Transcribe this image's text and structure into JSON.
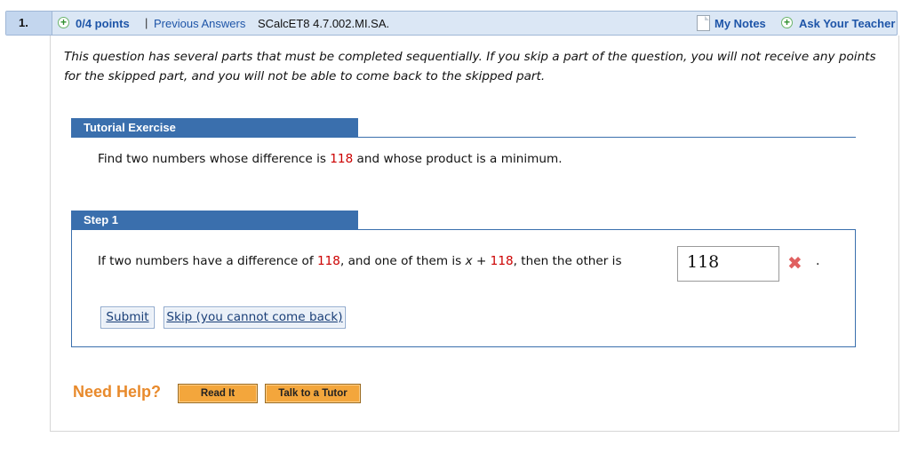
{
  "question": {
    "number": "1.",
    "points": "0/4 points",
    "separator": "|",
    "previous_answers": "Previous Answers",
    "id": "SCalcET8 4.7.002.MI.SA.",
    "my_notes": "My Notes",
    "ask_teacher": "Ask Your Teacher"
  },
  "intro": "This question has several parts that must be completed sequentially. If you skip a part of the question, you will not receive any points for the skipped part, and you will not be able to come back to the skipped part.",
  "tutorial": {
    "heading": "Tutorial Exercise",
    "problem_part1": "Find two numbers whose difference is ",
    "problem_value": "118",
    "problem_part2": " and whose product is a minimum."
  },
  "step": {
    "heading": "Step 1",
    "text_part1": "If two numbers have a difference of ",
    "diff_value": "118",
    "text_part2": ", and one of them is ",
    "var_x": "x",
    "plus": " + ",
    "offset_value": "118",
    "text_part3": ", then the other is",
    "answer_value": "118",
    "answer_status": "incorrect",
    "period": ".",
    "submit_label": "Submit",
    "skip_label": "Skip (you cannot come back)"
  },
  "help": {
    "label": "Need Help?",
    "read_it": "Read It",
    "talk_tutor": "Talk to a Tutor"
  },
  "colors": {
    "accent": "#3a6fad",
    "link": "#1e55a8",
    "value_red": "#cc0000",
    "help_orange": "#e88a2c",
    "button_orange": "#f3a63c"
  }
}
